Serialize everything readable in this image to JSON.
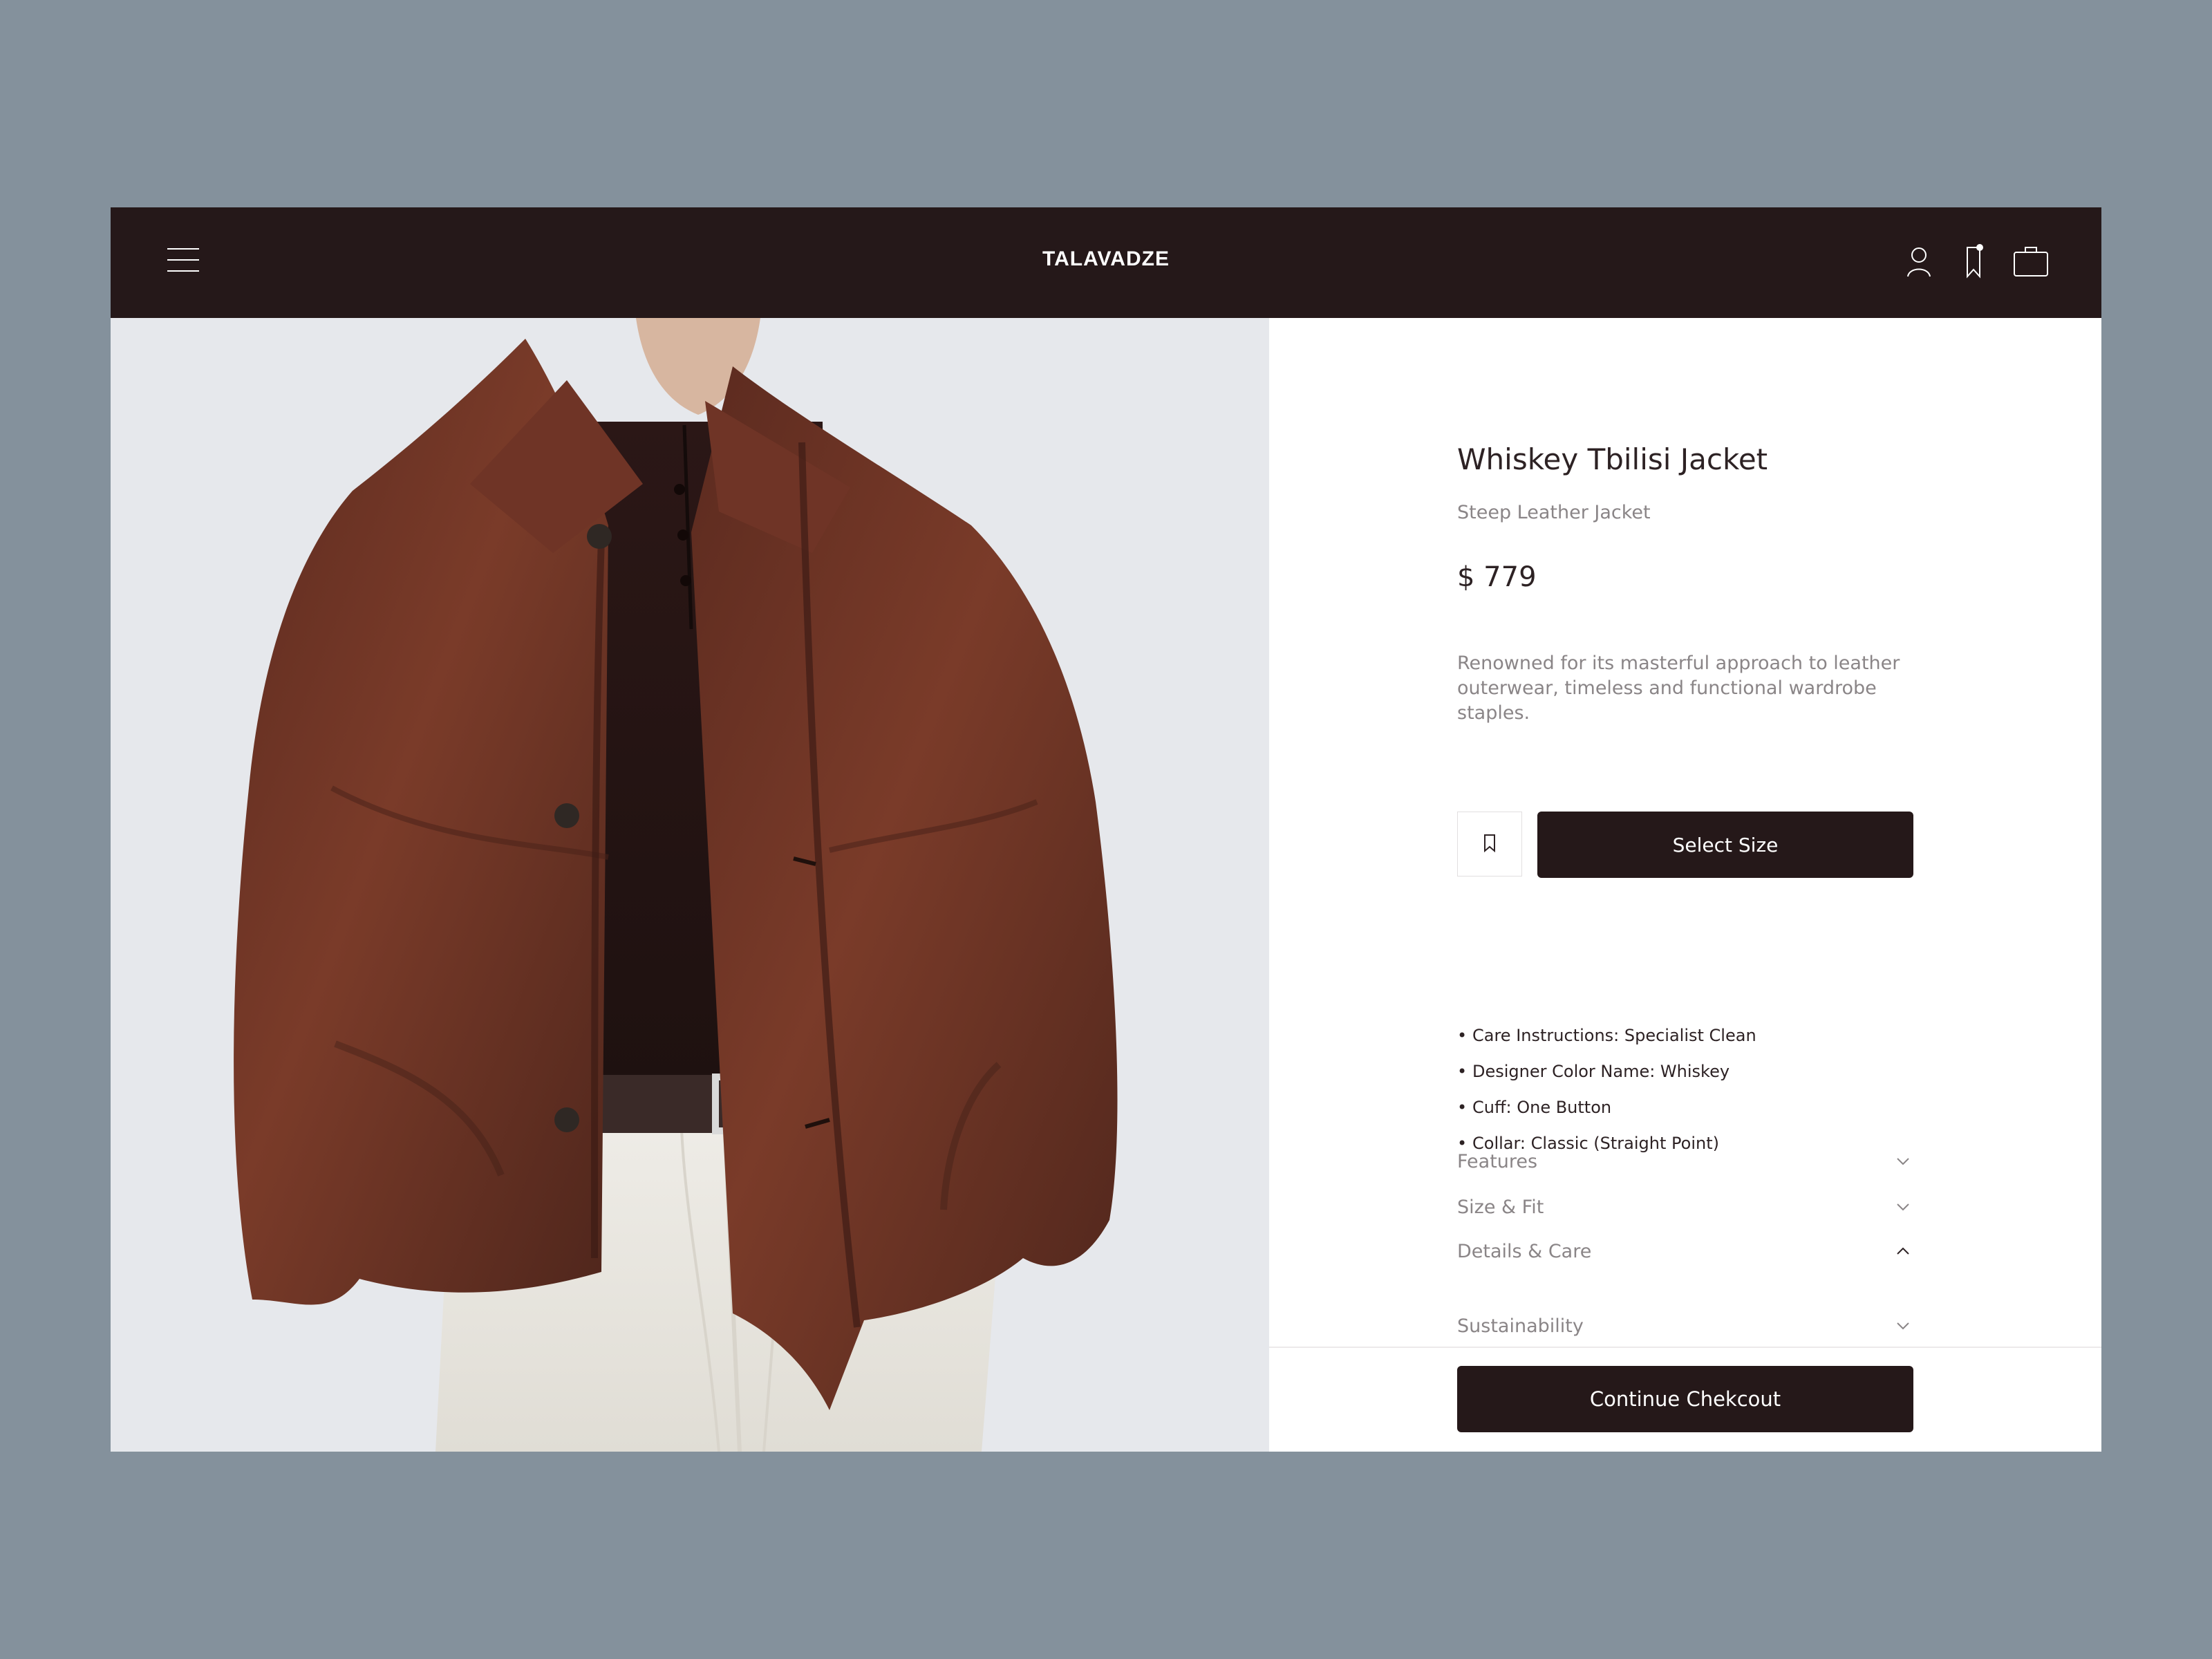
{
  "header": {
    "brand": "TALAVADZE",
    "icons": [
      "menu-icon",
      "account-icon",
      "bookmark-icon",
      "bag-icon"
    ]
  },
  "product": {
    "title": "Whiskey Tbilisi Jacket",
    "subtitle": "Steep Leather Jacket",
    "price": "$ 779",
    "description": "Renowned for its masterful approach to leather outerwear, timeless and functional wardrobe staples.",
    "select_size_label": "Select Size",
    "checkout_label": "Continue Chekcout"
  },
  "accordion": [
    {
      "label": "Features",
      "state": "collapsed"
    },
    {
      "label": "Size & Fit",
      "state": "collapsed"
    },
    {
      "label": "Details & Care",
      "state": "expanded"
    },
    {
      "label": "Sustainability",
      "state": "collapsed"
    }
  ],
  "details_care": [
    "Care Instructions: Specialist Clean",
    "Designer Color Name: Whiskey",
    "Cuff: One Button",
    "Collar: Classic (Straight Point)"
  ],
  "colors": {
    "background": "#84919c",
    "header": "#251819",
    "primary_button": "#251819",
    "text_dark": "#2d2224",
    "text_muted": "#8a8587",
    "jacket": "#6b3524"
  }
}
